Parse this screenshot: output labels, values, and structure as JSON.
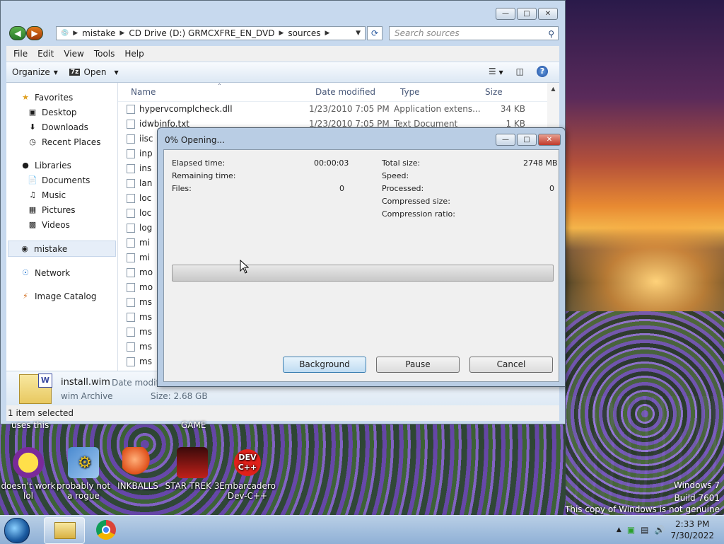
{
  "explorer": {
    "address": {
      "segments": [
        "mistake",
        "CD Drive (D:) GRMCXFRE_EN_DVD",
        "sources"
      ]
    },
    "search_placeholder": "Search sources",
    "menu": [
      "File",
      "Edit",
      "View",
      "Tools",
      "Help"
    ],
    "toolbar": {
      "organize": "Organize",
      "open": "Open"
    },
    "nav": {
      "favorites": "Favorites",
      "favorites_items": [
        "Desktop",
        "Downloads",
        "Recent Places"
      ],
      "libraries": "Libraries",
      "library_items": [
        "Documents",
        "Music",
        "Pictures",
        "Videos"
      ],
      "user": "mistake",
      "network": "Network",
      "image_catalog": "Image Catalog"
    },
    "columns": {
      "name": "Name",
      "date": "Date modified",
      "type": "Type",
      "size": "Size"
    },
    "files": [
      {
        "name": "hypervcomplcheck.dll",
        "date": "1/23/2010 7:05 PM",
        "type": "Application extens...",
        "size": "34 KB"
      },
      {
        "name": "idwbinfo.txt",
        "date": "1/23/2010 7:05 PM",
        "type": "Text Document",
        "size": "1 KB"
      },
      {
        "name": "iisc",
        "date": "",
        "type": "",
        "size": ""
      },
      {
        "name": "inp",
        "date": "",
        "type": "",
        "size": ""
      },
      {
        "name": "ins",
        "date": "",
        "type": "",
        "size": ""
      },
      {
        "name": "lan",
        "date": "",
        "type": "",
        "size": ""
      },
      {
        "name": "loc",
        "date": "",
        "type": "",
        "size": ""
      },
      {
        "name": "loc",
        "date": "",
        "type": "",
        "size": ""
      },
      {
        "name": "log",
        "date": "",
        "type": "",
        "size": ""
      },
      {
        "name": "mi",
        "date": "",
        "type": "",
        "size": ""
      },
      {
        "name": "mi",
        "date": "",
        "type": "",
        "size": ""
      },
      {
        "name": "mo",
        "date": "",
        "type": "",
        "size": ""
      },
      {
        "name": "mo",
        "date": "",
        "type": "",
        "size": ""
      },
      {
        "name": "ms",
        "date": "",
        "type": "",
        "size": ""
      },
      {
        "name": "ms",
        "date": "",
        "type": "",
        "size": ""
      },
      {
        "name": "ms",
        "date": "",
        "type": "",
        "size": ""
      },
      {
        "name": "ms",
        "date": "",
        "type": "",
        "size": ""
      },
      {
        "name": "ms",
        "date": "",
        "type": "",
        "size": ""
      }
    ],
    "details": {
      "name": "install.wim",
      "type": "wim Archive",
      "date_label": "Date modifie",
      "size": "Size: 2.68 GB"
    },
    "status": "1 item selected"
  },
  "dialog": {
    "title": "0% Opening...",
    "progress": 0,
    "stats": {
      "elapsed_label": "Elapsed time:",
      "elapsed_value": "00:00:03",
      "remaining_label": "Remaining time:",
      "files_label": "Files:",
      "files_value": "0",
      "total_label": "Total size:",
      "total_value": "2748 MB",
      "speed_label": "Speed:",
      "processed_label": "Processed:",
      "processed_value": "0",
      "compressed_label": "Compressed size:",
      "ratio_label": "Compression ratio:"
    },
    "buttons": {
      "background": "Background",
      "pause": "Pause",
      "cancel": "Cancel"
    }
  },
  "desktop": {
    "cut_labels": [
      "uses this",
      "GAME"
    ],
    "icons": [
      {
        "label": "doesn't work lol",
        "icon": "yahoo-messenger-icon"
      },
      {
        "label": "probably not a rogue",
        "icon": "gear-app-icon"
      },
      {
        "label": "INKBALLS",
        "icon": "inkball-icon"
      },
      {
        "label": "STAR TREK 3",
        "icon": "star-trek-icon"
      },
      {
        "label": "Embarcadero Dev-C++",
        "icon": "dev-cpp-icon"
      }
    ],
    "devcpp_logo": "DEV C++",
    "watermark": [
      "Windows 7",
      "Build 7601",
      "This copy of Windows is not genuine"
    ]
  },
  "taskbar": {
    "time": "2:33 PM",
    "date": "7/30/2022"
  }
}
